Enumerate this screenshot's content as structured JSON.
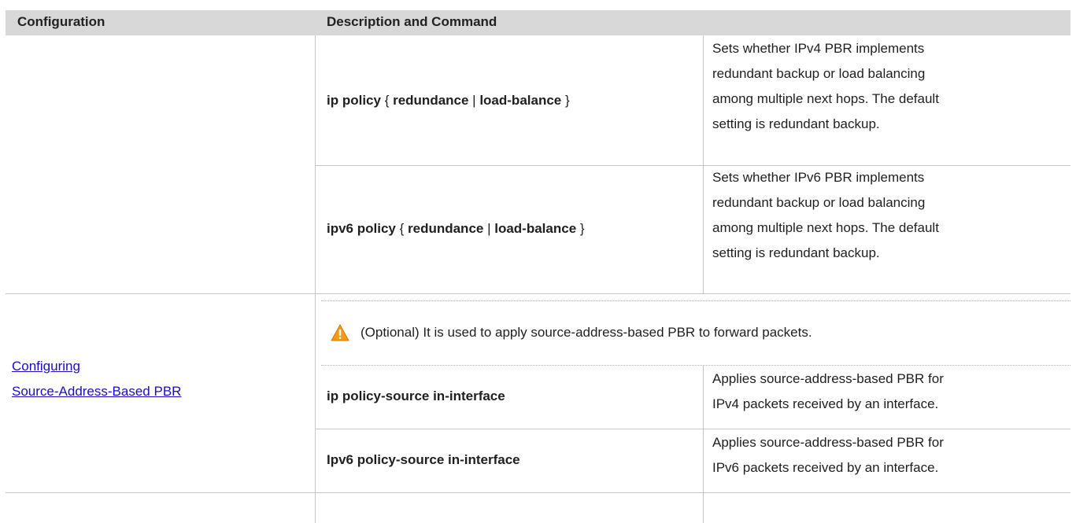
{
  "table": {
    "headers": [
      "Configuration",
      "Description and Command"
    ],
    "rows": [
      {
        "command_parts": [
          "ip policy",
          " { ",
          "redundance",
          " | ",
          "load-balance",
          " }"
        ],
        "description_lines": [
          "Sets whether IPv4 PBR implements",
          "redundant backup or load balancing",
          "among multiple next hops. The default",
          "setting is redundant backup."
        ]
      },
      {
        "command_parts": [
          "ipv6 policy",
          " { ",
          "redundance",
          " | ",
          "load-balance",
          " }"
        ],
        "description_lines": [
          "Sets whether IPv6 PBR implements",
          "redundant backup or load balancing",
          "among multiple next hops. The default",
          "setting is redundant backup."
        ]
      }
    ],
    "section": {
      "link_lines": [
        "Configuring ",
        "Source-Address-Based PBR"
      ],
      "note": "(Optional) It is used to apply source-address-based PBR to forward packets.",
      "rows": [
        {
          "command": "ip policy-source in-interface",
          "description_lines": [
            "Applies source-address-based PBR for",
            "IPv4 packets received by an interface."
          ]
        },
        {
          "command": "Ipv6 policy-source in-interface",
          "description_lines": [
            "Applies source-address-based PBR for",
            "IPv6 packets received by an interface."
          ]
        }
      ]
    }
  },
  "colors": {
    "header_bg": "#d8d8d8",
    "link": "#1a0dcc",
    "warning": "#f39c12"
  }
}
